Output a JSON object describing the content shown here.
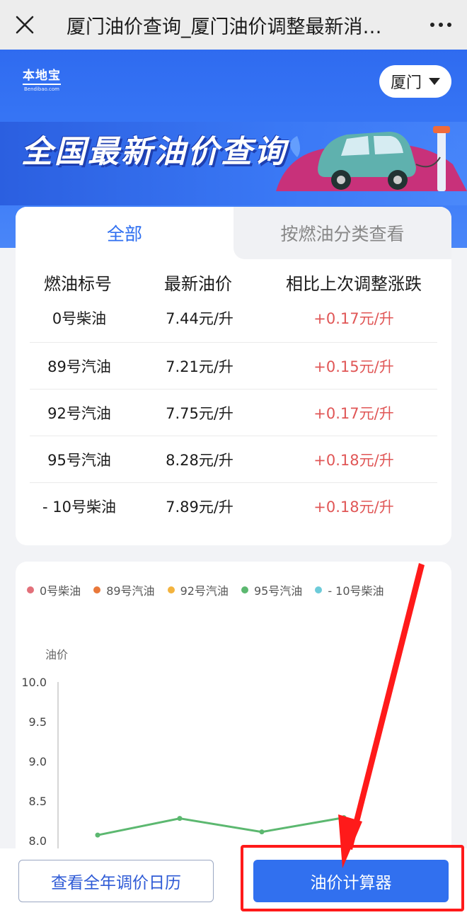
{
  "topbar": {
    "title": "厦门油价查询_厦门油价调整最新消…"
  },
  "hero": {
    "logo_main": "本地宝",
    "logo_sub": "Bendibao.com",
    "city": "厦门",
    "title": "全国最新油价查询"
  },
  "tabs": [
    {
      "label": "全部"
    },
    {
      "label": "按燃油分类查看"
    }
  ],
  "table": {
    "headers": [
      "燃油标号",
      "最新油价",
      "相比上次调整涨跌"
    ],
    "rows": [
      {
        "grade": "0号柴油",
        "price": "7.44元/升",
        "change": "+0.17元/升"
      },
      {
        "grade": "89号汽油",
        "price": "7.21元/升",
        "change": "+0.15元/升"
      },
      {
        "grade": "92号汽油",
        "price": "7.75元/升",
        "change": "+0.17元/升"
      },
      {
        "grade": "95号汽油",
        "price": "8.28元/升",
        "change": "+0.18元/升"
      },
      {
        "grade": "- 10号柴油",
        "price": "7.89元/升",
        "change": "+0.18元/升"
      }
    ]
  },
  "chart_data": {
    "type": "line",
    "ylabel": "油价",
    "ylim": [
      8.0,
      10.0
    ],
    "yticks": [
      "10.0",
      "9.5",
      "9.0",
      "8.5",
      "8.0"
    ],
    "legend": [
      {
        "name": "0号柴油",
        "color": "#e2707a"
      },
      {
        "name": "89号汽油",
        "color": "#e9783a"
      },
      {
        "name": "92号汽油",
        "color": "#f3b33e"
      },
      {
        "name": "95号汽油",
        "color": "#5cb870"
      },
      {
        "name": "- 10号柴油",
        "color": "#6dcbd9"
      }
    ],
    "series": [
      {
        "name": "95号汽油",
        "color": "#5cb870",
        "values": [
          8.07,
          8.28,
          8.11,
          8.29
        ]
      }
    ]
  },
  "buttons": {
    "calendar": "查看全年调价日历",
    "calculator": "油价计算器"
  },
  "colors": {
    "accent": "#3170ef",
    "change_up": "#e05656",
    "annotation": "#ff1a1a"
  }
}
